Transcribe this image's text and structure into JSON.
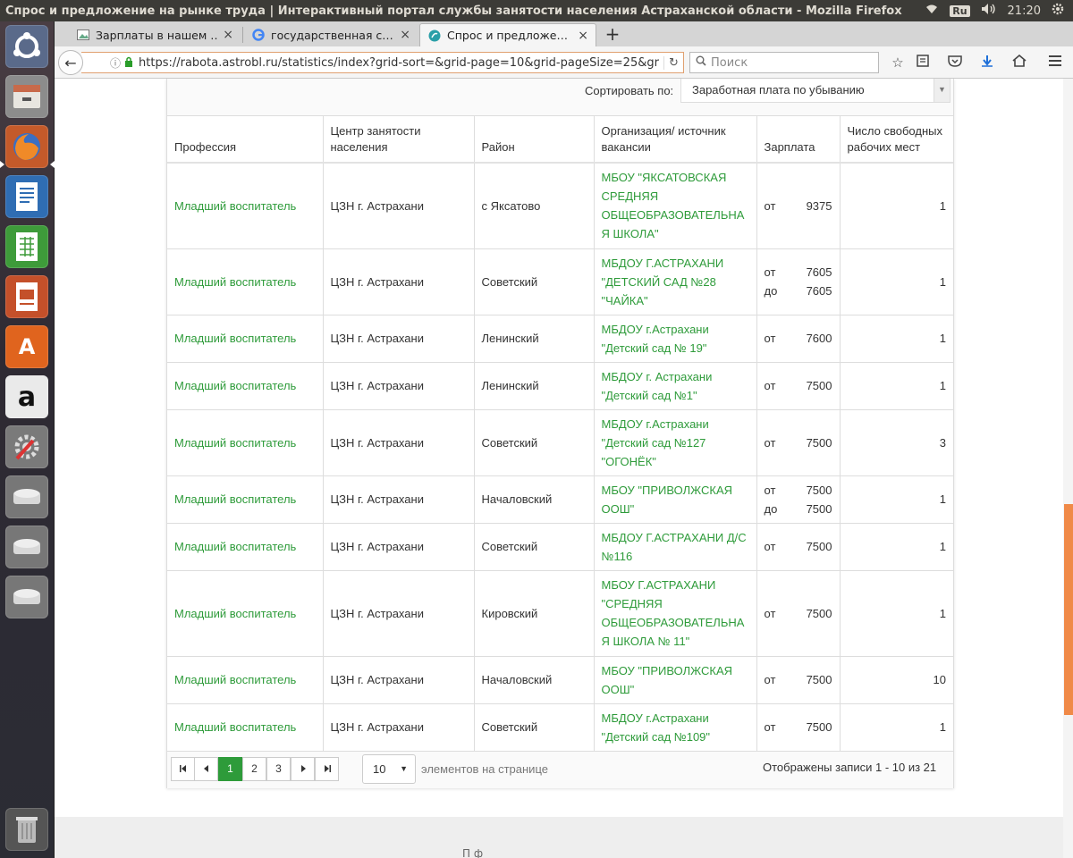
{
  "system": {
    "window_title": "Спрос и предложение на рынке труда | Интерактивный портал службы занятости населения Астраханской области - Mozilla Firefox",
    "keyboard_layout": "Ru",
    "clock": "21:20"
  },
  "browser": {
    "tabs": [
      {
        "label": "Зарплаты в нашем …",
        "favicon": "image-icon",
        "active": false
      },
      {
        "label": "государственная с…",
        "favicon": "google-icon",
        "active": false
      },
      {
        "label": "Спрос и предложе…",
        "favicon": "site-icon",
        "active": true
      }
    ],
    "url": "https://rabota.astrobl.ru/statistics/index?grid-sort=&grid-page=10&grid-pageSize=25&gr",
    "search_placeholder": "Поиск"
  },
  "sort": {
    "label": "Сортировать по:",
    "selected": "Заработная плата по убыванию"
  },
  "table": {
    "headers": {
      "profession": "Профессия",
      "center": "Центр занятости населения",
      "district": "Район",
      "org": "Организация/ источник вакансии",
      "salary": "Зарплата",
      "vacancies": "Число свободных рабочих мест"
    },
    "rows": [
      {
        "profession": "Младший воспитатель",
        "center": "ЦЗН г. Астрахани",
        "district": "с Яксатово",
        "org": "МБОУ \"ЯКСАТОВСКАЯ СРЕДНЯЯ ОБЩЕОБРАЗОВАТЕЛЬНА Я ШКОЛА\"",
        "sal_from": "9375",
        "sal_to": "",
        "vacancies": "1"
      },
      {
        "profession": "Младший воспитатель",
        "center": "ЦЗН г. Астрахани",
        "district": "Советский",
        "org": "МБДОУ Г.АСТРАХАНИ \"ДЕТСКИЙ САД №28 \"ЧАЙКА\"",
        "sal_from": "7605",
        "sal_to": "7605",
        "vacancies": "1"
      },
      {
        "profession": "Младший воспитатель",
        "center": "ЦЗН г. Астрахани",
        "district": "Ленинский",
        "org": "МБДОУ г.Астрахани \"Детский сад № 19\"",
        "sal_from": "7600",
        "sal_to": "",
        "vacancies": "1"
      },
      {
        "profession": "Младший воспитатель",
        "center": "ЦЗН г. Астрахани",
        "district": "Ленинский",
        "org": "МБДОУ г. Астрахани \"Детский сад №1\"",
        "sal_from": "7500",
        "sal_to": "",
        "vacancies": "1"
      },
      {
        "profession": "Младший воспитатель",
        "center": "ЦЗН г. Астрахани",
        "district": "Советский",
        "org": "МБДОУ г.Астрахани \"Детский сад №127 \"ОГОНЁК\"",
        "sal_from": "7500",
        "sal_to": "",
        "vacancies": "3"
      },
      {
        "profession": "Младший воспитатель",
        "center": "ЦЗН г. Астрахани",
        "district": "Началовский",
        "org": "МБОУ \"ПРИВОЛЖСКАЯ ООШ\"",
        "sal_from": "7500",
        "sal_to": "7500",
        "vacancies": "1"
      },
      {
        "profession": "Младший воспитатель",
        "center": "ЦЗН г. Астрахани",
        "district": "Советский",
        "org": "МБДОУ Г.АСТРАХАНИ Д/С №116",
        "sal_from": "7500",
        "sal_to": "",
        "vacancies": "1"
      },
      {
        "profession": "Младший воспитатель",
        "center": "ЦЗН г. Астрахани",
        "district": "Кировский",
        "org": "МБОУ Г.АСТРАХАНИ \"СРЕДНЯЯ ОБЩЕОБРАЗОВАТЕЛЬНА Я ШКОЛА № 11\"",
        "sal_from": "7500",
        "sal_to": "",
        "vacancies": "1"
      },
      {
        "profession": "Младший воспитатель",
        "center": "ЦЗН г. Астрахани",
        "district": "Началовский",
        "org": "МБОУ \"ПРИВОЛЖСКАЯ ООШ\"",
        "sal_from": "7500",
        "sal_to": "",
        "vacancies": "10"
      },
      {
        "profession": "Младший воспитатель",
        "center": "ЦЗН г. Астрахани",
        "district": "Советский",
        "org": "МБДОУ г.Астрахани \"Детский сад №109\"",
        "sal_from": "7500",
        "sal_to": "",
        "vacancies": "1"
      }
    ],
    "salary_from_prefix": "от",
    "salary_to_prefix": "до"
  },
  "pager": {
    "first": "◂◂",
    "prev": "◂",
    "pages": [
      "1",
      "2",
      "3"
    ],
    "current_page": "1",
    "next": "▸",
    "last": "▸▸",
    "page_size": "10",
    "page_size_label": "элементов на странице",
    "records_info": "Отображены записи 1 - 10 из 21"
  },
  "footer": {
    "fragment": "П                       ф"
  },
  "colors": {
    "accent_green": "#2e9b3a",
    "scroll_thumb": "#f08a48",
    "panel_bg": "#3c3b37"
  }
}
